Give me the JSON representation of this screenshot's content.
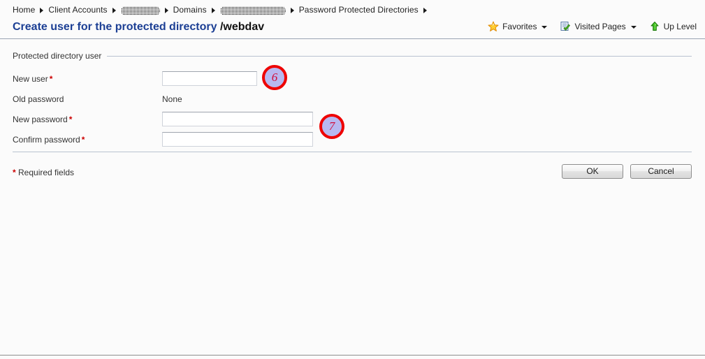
{
  "breadcrumb": {
    "items": [
      {
        "label": "Home",
        "type": "link"
      },
      {
        "label": "Client Accounts",
        "type": "link"
      },
      {
        "label": "",
        "type": "redacted",
        "width": "w1"
      },
      {
        "label": "Domains",
        "type": "link"
      },
      {
        "label": "",
        "type": "redacted",
        "width": "w2"
      },
      {
        "label": "Password Protected Directories",
        "type": "link"
      }
    ]
  },
  "header": {
    "title": "Create user for the protected directory",
    "directory": "/webdav"
  },
  "toolbar": {
    "favorites_label": "Favorites",
    "favorites_icon": "star-icon",
    "visited_pages_label": "Visited Pages",
    "visited_pages_icon": "page-check-icon",
    "up_level_label": "Up Level",
    "up_level_icon": "green-up-arrow-icon"
  },
  "section": {
    "legend": "Protected directory user",
    "fields": [
      {
        "label": "New user",
        "required": true,
        "required_marker": "*",
        "type": "text",
        "value": "",
        "placeholder": ""
      },
      {
        "label": "Old password",
        "required": false,
        "required_marker": "",
        "type": "static",
        "value": "None"
      },
      {
        "label": "New password",
        "required": true,
        "required_marker": "*",
        "type": "password",
        "value": "",
        "placeholder": ""
      },
      {
        "label": "Confirm password",
        "required": true,
        "required_marker": "*",
        "type": "password",
        "value": "",
        "placeholder": ""
      }
    ]
  },
  "footer": {
    "required_marker": "*",
    "required_note": "Required fields",
    "ok_label": "OK",
    "cancel_label": "Cancel"
  },
  "annotations": [
    {
      "number": "6"
    },
    {
      "number": "7"
    }
  ],
  "colors": {
    "title_blue": "#1c3f94",
    "required_red": "#cc0000",
    "annotation_ring": "#ee0000",
    "annotation_fill": "#b8b8f0",
    "annotation_text": "#d10f3c",
    "rule": "#b9c2d0",
    "page_background": "#fbfbfb"
  }
}
